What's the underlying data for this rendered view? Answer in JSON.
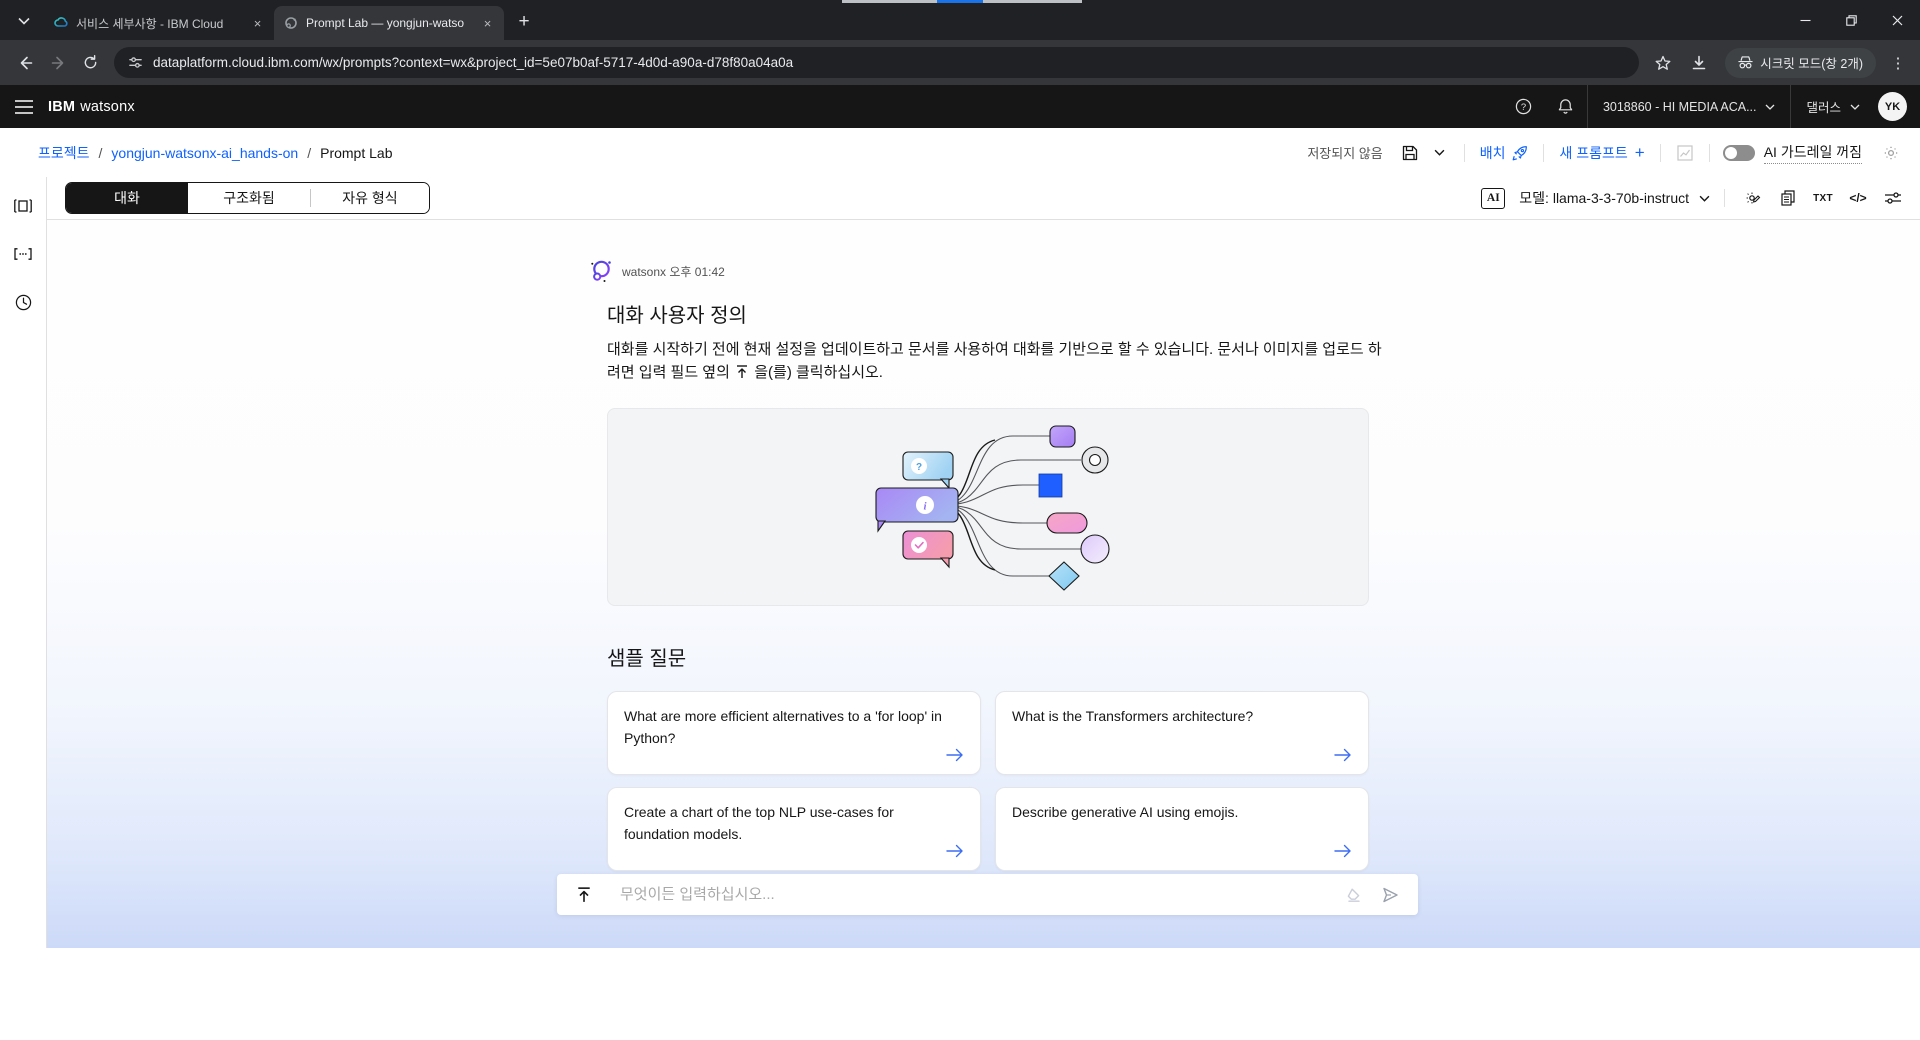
{
  "browser": {
    "tabs": [
      {
        "title": "서비스 세부사항 - IBM Cloud",
        "active": false
      },
      {
        "title": "Prompt Lab — yongjun-watso",
        "active": true
      }
    ],
    "url": "dataplatform.cloud.ibm.com/wx/prompts?context=wx&project_id=5e07b0af-5717-4d0d-a90a-d78f80a04a0a",
    "incognito_badge": "시크릿 모드(창 2개)",
    "glyphs": {
      "close_tab": "×",
      "new_tab": "+",
      "kebab": "⋮"
    }
  },
  "header": {
    "brand_ibm": "IBM",
    "brand_product": "watsonx",
    "account": "3018860 - HI MEDIA ACA...",
    "region": "댈러스",
    "avatar_initials": "YK"
  },
  "breadcrumb": {
    "item1": "프로젝트",
    "item2": "yongjun-watsonx-ai_hands-on",
    "item3": "Prompt Lab",
    "separator": "/"
  },
  "toolbar": {
    "save_status": "저장되지 않음",
    "deploy_label": "배치",
    "new_prompt_label": "새 프롬프트",
    "new_prompt_plus": "+",
    "guardrail_label": "AI 가드레일 꺼짐"
  },
  "mode_tabs": {
    "tab1": "대화",
    "tab2": "구조화됨",
    "tab3": "자유 형식"
  },
  "model_bar": {
    "ai_badge": "AI",
    "model_label": "모델: llama-3-3-70b-instruct",
    "txt_label": "TXT",
    "code_label": "</>"
  },
  "chat": {
    "sender": "watsonx",
    "timestamp": "오후 01:42",
    "title": "대화 사용자 정의",
    "description_before": "대화를 시작하기 전에 현재 설정을 업데이트하고 문서를 사용하여 대화를 기반으로 할 수 있습니다. 문서나 이미지를 업로드 하려면 입력 필드 옆의",
    "description_after": "을(를) 클릭하십시오."
  },
  "samples": {
    "heading": "샘플 질문",
    "questions": [
      "What are more efficient alternatives to a 'for loop' in Python?",
      "What is the Transformers architecture?",
      "Create a chart of the top NLP use-cases for foundation models.",
      "Describe generative AI using emojis."
    ]
  },
  "input": {
    "placeholder": "무엇이든 입력하십시오..."
  },
  "colors": {
    "accent_blue": "#0f62fe",
    "header_bg": "#161616",
    "chrome_dark": "#202124",
    "chrome_toolbar": "#35363a"
  }
}
